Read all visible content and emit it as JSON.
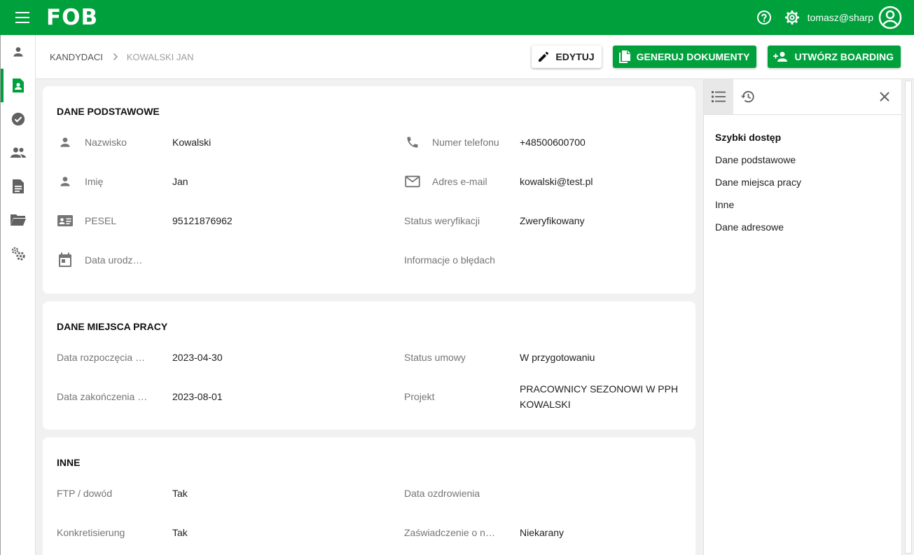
{
  "appbar": {
    "logo": "FOB",
    "user_email": "tomasz@sharp",
    "colors": {
      "primary": "#00a03c"
    },
    "icons": [
      "menu-icon",
      "help-icon",
      "gear-icon",
      "account-circle-icon"
    ]
  },
  "sidebar": {
    "items": [
      {
        "name": "person",
        "icon": "person-icon"
      },
      {
        "name": "candidates",
        "icon": "assignment-ind-icon",
        "active": true
      },
      {
        "name": "approvals",
        "icon": "check-circle-icon"
      },
      {
        "name": "groups",
        "icon": "people-icon"
      },
      {
        "name": "documents",
        "icon": "description-icon"
      },
      {
        "name": "folders",
        "icon": "folder-open-icon"
      },
      {
        "name": "settings",
        "icon": "settings-gears-icon"
      }
    ]
  },
  "breadcrumb": {
    "root": "KANDYDACI",
    "current": "KOWALSKI JAN"
  },
  "toolbar": {
    "edit_label": "EDYTUJ",
    "generate_label": "GENERUJ DOKUMENTY",
    "boarding_label": "UTWÓRZ BOARDING"
  },
  "sections": {
    "basic": {
      "title": "DANE PODSTAWOWE",
      "fields": {
        "surname": {
          "label": "Nazwisko",
          "value": "Kowalski"
        },
        "first_name": {
          "label": "Imię",
          "value": "Jan"
        },
        "pesel": {
          "label": "PESEL",
          "value": "95121876962"
        },
        "birth_date": {
          "label": "Data urodzenia",
          "value": ""
        },
        "phone": {
          "label": "Numer telefonu",
          "value": "+48500600700"
        },
        "email": {
          "label": "Adres e-mail",
          "value": "kowalski@test.pl"
        },
        "verification": {
          "label": "Status weryfikacji",
          "value": "Zweryfikowany"
        },
        "errors": {
          "label": "Informacje o błędach",
          "value": ""
        }
      }
    },
    "workplace": {
      "title": "DANE MIEJSCA PRACY",
      "fields": {
        "start_date": {
          "label": "Data rozpoczęcia umowy",
          "value": "2023-04-30"
        },
        "end_date": {
          "label": "Data zakończenia umowy",
          "value": "2023-08-01"
        },
        "contract_status": {
          "label": "Status umowy",
          "value": "W przygotowaniu"
        },
        "project": {
          "label": "Projekt",
          "value": "PRACOWNICY SEZONOWI W PPH KOWALSKI"
        }
      }
    },
    "other": {
      "title": "INNE",
      "fields": {
        "ftp": {
          "label": "FTP / dowód",
          "value": "Tak"
        },
        "konkretisierung": {
          "label": "Konkretisierung",
          "value": "Tak"
        },
        "recovery_date": {
          "label": "Data ozdrowienia",
          "value": ""
        },
        "certificate": {
          "label": "Zaświadczenie o niekaralności",
          "value": "Niekarany"
        }
      }
    }
  },
  "quick_access": {
    "heading": "Szybki dostęp",
    "links": [
      "Dane podstawowe",
      "Dane miejsca pracy",
      "Inne",
      "Dane adresowe"
    ]
  }
}
